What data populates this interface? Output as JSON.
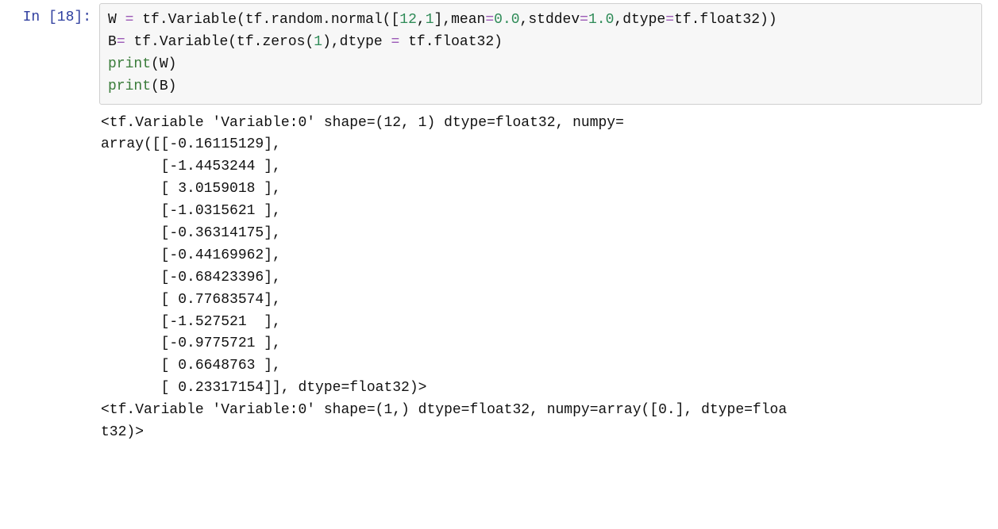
{
  "cell": {
    "prompt_label": "In ",
    "prompt_open": "[",
    "prompt_num": "18",
    "prompt_close": "]:",
    "code": {
      "l1_p1": "W ",
      "l1_op1": "=",
      "l1_p2": " tf.Variable(tf.random.normal([",
      "l1_n1": "12",
      "l1_c1": ",",
      "l1_n2": "1",
      "l1_p3": "],mean",
      "l1_op2": "=",
      "l1_n3": "0.0",
      "l1_c2": ",stddev",
      "l1_op3": "=",
      "l1_n4": "1.0",
      "l1_c3": ",dtype",
      "l1_op4": "=",
      "l1_p4": "tf.float32))",
      "l2_p1": "B",
      "l2_op1": "=",
      "l2_p2": " tf.Variable(tf.zeros(",
      "l2_n1": "1",
      "l2_p3": "),dtype ",
      "l2_op2": "=",
      "l2_p4": " tf.float32)",
      "l3_fn": "print",
      "l3_arg": "(W)",
      "l4_fn": "print",
      "l4_arg": "(B)"
    },
    "output": "<tf.Variable 'Variable:0' shape=(12, 1) dtype=float32, numpy=\narray([[-0.16115129],\n       [-1.4453244 ],\n       [ 3.0159018 ],\n       [-1.0315621 ],\n       [-0.36314175],\n       [-0.44169962],\n       [-0.68423396],\n       [ 0.77683574],\n       [-1.527521  ],\n       [-0.9775721 ],\n       [ 0.6648763 ],\n       [ 0.23317154]], dtype=float32)>\n<tf.Variable 'Variable:0' shape=(1,) dtype=float32, numpy=array([0.], dtype=floa\nt32)>"
  }
}
